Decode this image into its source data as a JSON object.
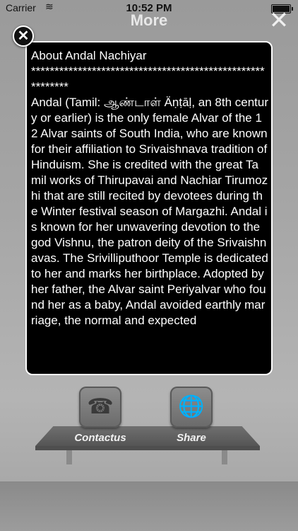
{
  "status_bar": {
    "carrier": "Carrier",
    "time": "10:52 PM",
    "wifi_icon": "wifi-icon",
    "battery_icon": "battery-icon"
  },
  "nav": {
    "title": "More",
    "close_icon": "close-icon"
  },
  "modal": {
    "close_icon": "close-circle-icon",
    "text": "About Andal Nachiyar\n**********************************************************\nAndal (Tamil: ஆண்டாள் Äṇṭāḷ, an 8th century or earlier) is the only female Alvar of the 12 Alvar saints of South India, who are known for their affiliation to Srivaishnava tradition of Hinduism. She is credited with the great Tamil works of Thirupavai and Nachiar Tirumozhi that are still recited by devotees during the Winter festival season of Margazhi. Andal is known for her unwavering devotion to the god Vishnu, the patron deity of the Srivaishnavas. The Srivilliputhoor Temple is dedicated to her and marks her birthplace. Adopted by her father, the Alvar saint Periyalvar who found her as a baby, Andal avoided earthly marriage, the normal and expected"
  },
  "shelf": {
    "contactus_label": "Contactus",
    "share_label": "Share",
    "contactus_icon": "telephone-icon",
    "share_icon": "share-globe-icon"
  }
}
